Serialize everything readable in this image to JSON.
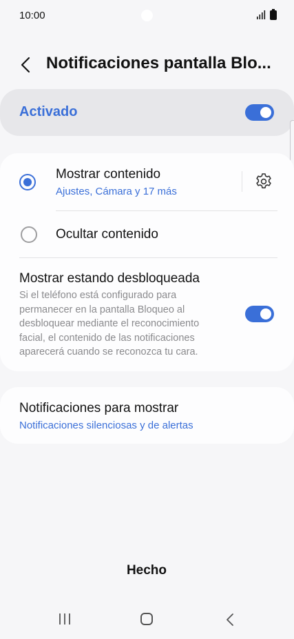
{
  "status_bar": {
    "time": "10:00"
  },
  "header": {
    "title": "Notificaciones pantalla Blo..."
  },
  "master": {
    "label": "Activado",
    "enabled": true
  },
  "options": [
    {
      "title": "Mostrar contenido",
      "subtitle": "Ajustes, Cámara y 17 más",
      "selected": true
    },
    {
      "title": "Ocultar contenido",
      "selected": false
    }
  ],
  "unlocked": {
    "title": "Mostrar estando desbloqueada",
    "description": "Si el teléfono está configurado para permanecer en la pantalla Bloqueo al desbloquear mediante el reconocimiento facial, el contenido de las notificaciones aparecerá cuando se reconozca tu cara.",
    "enabled": true
  },
  "notifications_to_show": {
    "title": "Notificaciones para mostrar",
    "subtitle": "Notificaciones silenciosas y de alertas"
  },
  "footer": {
    "done_label": "Hecho"
  },
  "colors": {
    "accent": "#3a6fd8",
    "background": "#f6f6f8"
  }
}
